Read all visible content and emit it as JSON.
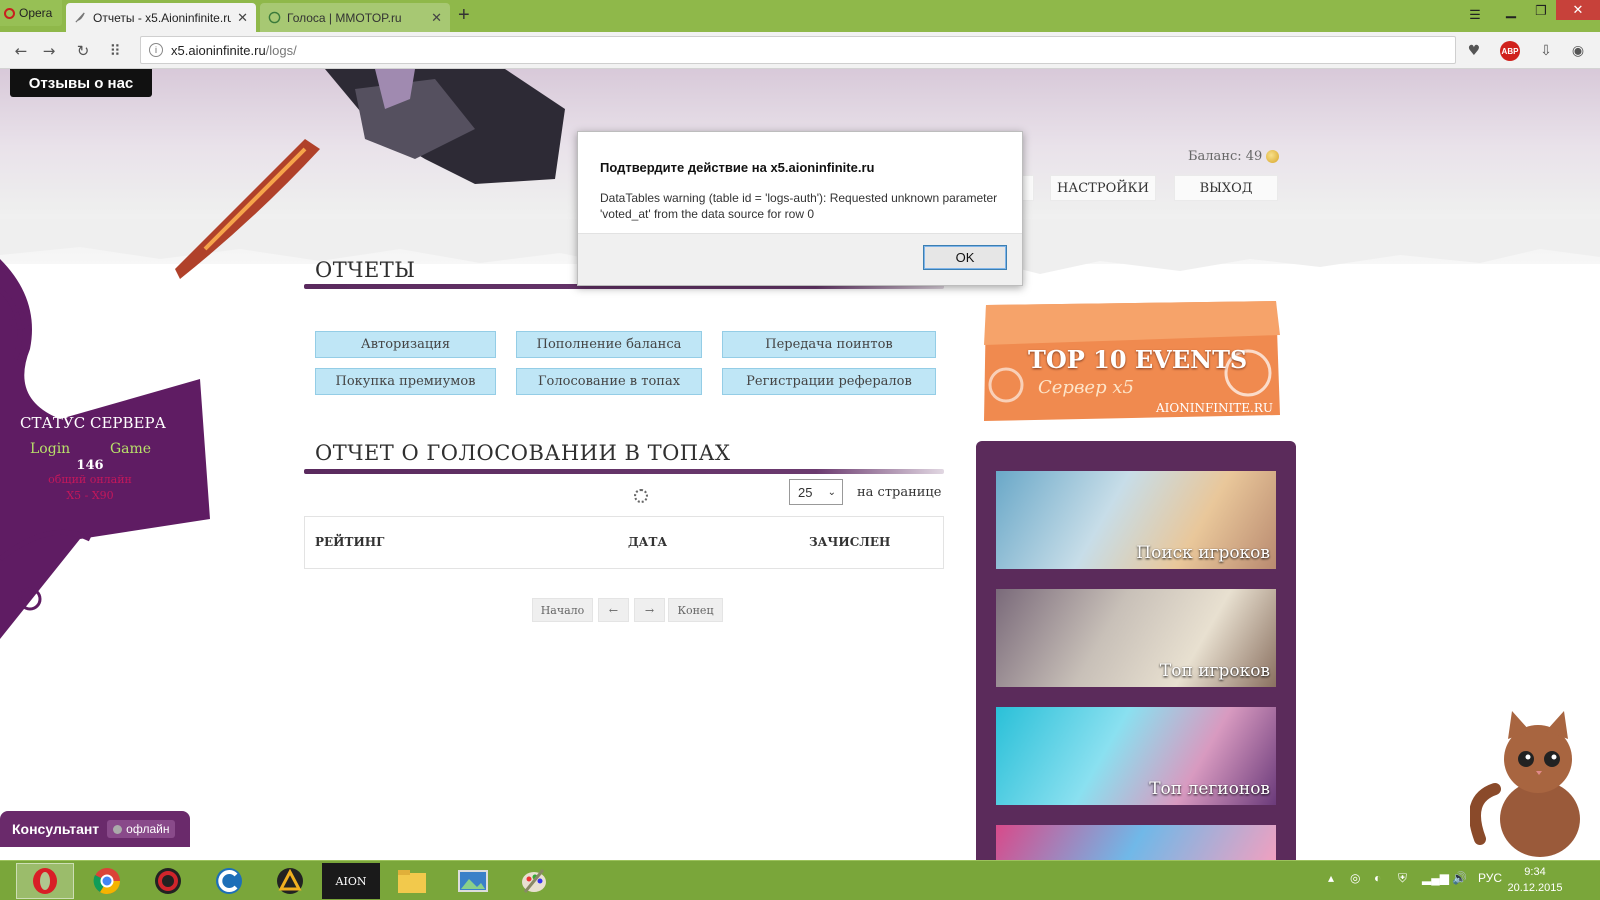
{
  "browser": {
    "menu_label": "Opera",
    "tabs": [
      {
        "title": "Отчеты - x5.Aioninfinite.ru",
        "active": true
      },
      {
        "title": "Голоса | MMOTOP.ru",
        "active": false
      }
    ],
    "url_host": "x5.aioninfinite.ru",
    "url_path": "/logs/"
  },
  "site": {
    "reviews_button": "Отзывы о нас",
    "balance_label": "Баланс: 49",
    "nav": {
      "settings": "НАСТРОЙКИ",
      "logout": "ВЫХОД"
    }
  },
  "server_status": {
    "title": "СТАТУС СЕРВЕРА",
    "login": "Login",
    "game": "Game",
    "online_count": "146",
    "online_label": "общий онлайн",
    "rates": "X5 - X90"
  },
  "reports": {
    "title": "ОТЧЕТЫ",
    "buttons": [
      "Авторизация",
      "Пополнение баланса",
      "Передача поинтов",
      "Покупка премиумов",
      "Голосование в топах",
      "Регистрации рефералов"
    ]
  },
  "vote_report": {
    "title": "ОТЧЕТ О ГОЛОСОВАНИИ В ТОПАХ",
    "per_page_value": "25",
    "per_page_label": "на странице",
    "columns": [
      "РЕЙТИНГ",
      "ДАТА",
      "ЗАЧИСЛЕН"
    ],
    "pager": {
      "first": "Начало",
      "prev": "←",
      "next": "→",
      "last": "Конец"
    }
  },
  "sidebar": {
    "events_title": "TOP 10 EVENTS",
    "events_subtitle": "Сервер x5",
    "events_site": "AIONINFINITE.RU",
    "promos": [
      "Поиск игроков",
      "Топ игроков",
      "Топ легионов"
    ]
  },
  "consultant": {
    "label": "Консультант",
    "status": "офлайн"
  },
  "dialog": {
    "title": "Подтвердите действие на x5.aioninfinite.ru",
    "message": "DataTables warning (table id = 'logs-auth'): Requested unknown parameter 'voted_at' from the data source for row 0",
    "ok": "OK"
  },
  "taskbar": {
    "apps": [
      "opera-icon",
      "chrome-icon",
      "game-launcher-icon",
      "ccleaner-icon",
      "arena-icon",
      "aion-icon",
      "file-explorer-icon",
      "photo-viewer-icon",
      "paint-icon"
    ],
    "aion_label": "AION",
    "lang": "РУС",
    "time": "9:34",
    "date": "20.12.2015"
  },
  "colors": {
    "browser_green": "#8fb84a",
    "site_purple": "#5b2b5b",
    "report_button": "#bfe6f6",
    "taskbar": "#7aa63a"
  }
}
